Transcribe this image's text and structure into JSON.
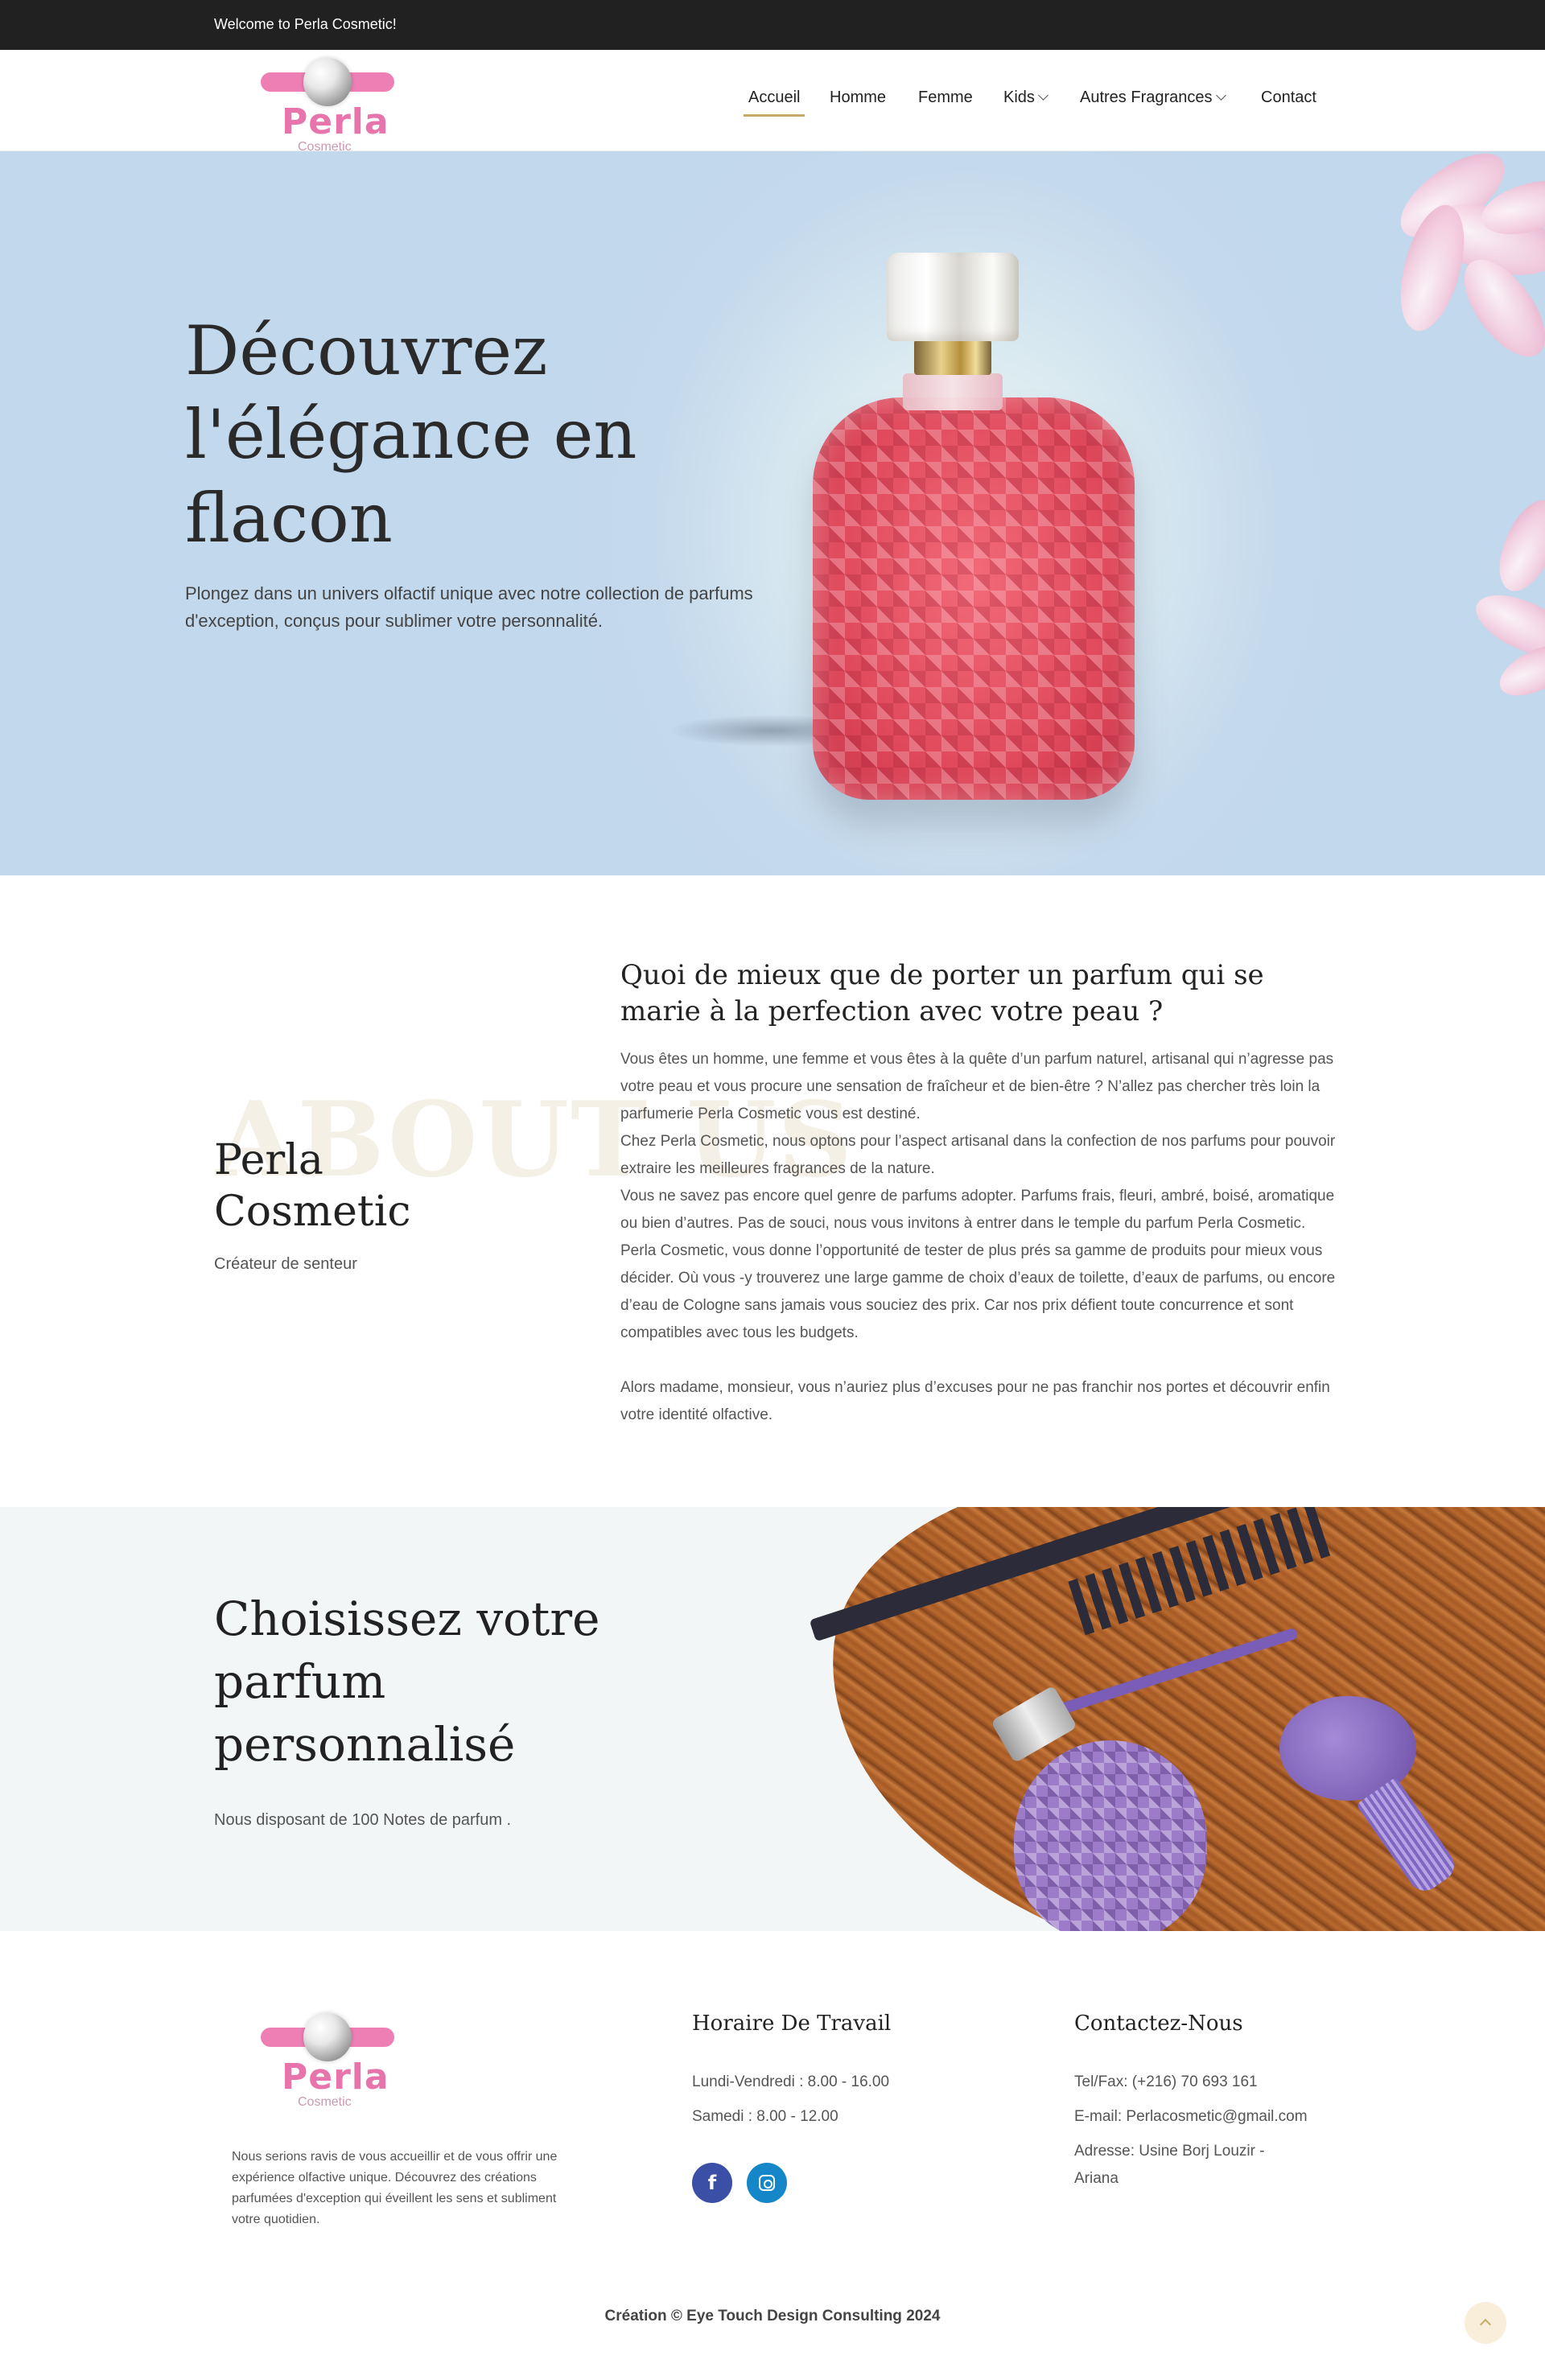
{
  "topbar": {
    "welcome": "Welcome to Perla Cosmetic!"
  },
  "brand": {
    "name": "Perla",
    "tagline": "Cosmetic",
    "pink": "#ee7fb4"
  },
  "nav": {
    "items": [
      {
        "label": "Accueil",
        "active": true,
        "dropdown": false
      },
      {
        "label": "Homme",
        "active": false,
        "dropdown": false
      },
      {
        "label": "Femme",
        "active": false,
        "dropdown": false
      },
      {
        "label": "Kids",
        "active": false,
        "dropdown": true
      },
      {
        "label": "Autres Fragrances",
        "active": false,
        "dropdown": true
      },
      {
        "label": "Contact",
        "active": false,
        "dropdown": false
      }
    ],
    "accent": "#c8a96a"
  },
  "hero": {
    "title": "Découvrez l'élégance en flacon",
    "text": "Plongez dans un univers olfactif unique avec notre collection de parfums d'exception, conçus pour sublimer votre personnalité."
  },
  "about": {
    "ghost": "ABOUT US",
    "title": "Perla Cosmetic",
    "subtitle": "Créateur de senteur",
    "heading": "Quoi de mieux que de porter un parfum qui se marie à la perfection avec votre peau ?",
    "paragraphs": [
      "Vous êtes un homme, une femme et vous êtes à la quête d’un parfum naturel, artisanal qui n’agresse pas votre peau et vous procure une sensation de fraîcheur et de bien-être ? N’allez pas chercher très loin la parfumerie Perla Cosmetic vous est destiné.",
      "Chez Perla Cosmetic, nous optons pour l’aspect artisanal dans la confection de nos parfums pour pouvoir extraire les meilleures fragrances de la nature.",
      "Vous ne savez pas encore quel genre de parfums adopter. Parfums frais, fleuri, ambré, boisé, aromatique ou bien d’autres. Pas de souci, nous vous invitons à entrer dans le temple du parfum Perla Cosmetic. Perla Cosmetic, vous donne l’opportunité de tester de plus prés sa gamme de produits pour mieux vous décider. Où vous -y trouverez une large gamme de choix d’eaux de toilette, d’eaux de parfums, ou encore d’eau de Cologne sans jamais vous souciez des prix. Car nos prix défient toute concurrence et sont compatibles avec tous les budgets.",
      "Alors madame, monsieur, vous n’auriez plus d’excuses pour ne pas franchir nos portes et découvrir enfin votre identité olfactive."
    ]
  },
  "choose": {
    "title": "Choisissez votre parfum personnalisé",
    "text": "Nous disposant de 100 Notes de parfum ."
  },
  "footer": {
    "description": "Nous serions ravis de vous accueillir et de vous offrir une expérience olfactive unique. Découvrez des créations parfumées d'exception qui éveillent les sens et subliment votre quotidien.",
    "hours_title": "Horaire De Travail",
    "hours": [
      "Lundi-Vendredi : 8.00 - 16.00",
      "Samedi : 8.00 - 12.00"
    ],
    "contact_title": "Contactez-Nous",
    "contact": [
      "Tel/Fax: (+216) 70 693 161",
      "E-mail: Perlacosmetic@gmail.com",
      "Adresse: Usine Borj Louzir -",
      "Ariana"
    ],
    "social": [
      {
        "icon": "facebook-icon",
        "glyph": "f",
        "color": "#3b4fa6"
      },
      {
        "icon": "instagram-icon",
        "color": "#1587c9"
      }
    ],
    "copyright": "Création © Eye Touch Design Consulting 2024"
  }
}
